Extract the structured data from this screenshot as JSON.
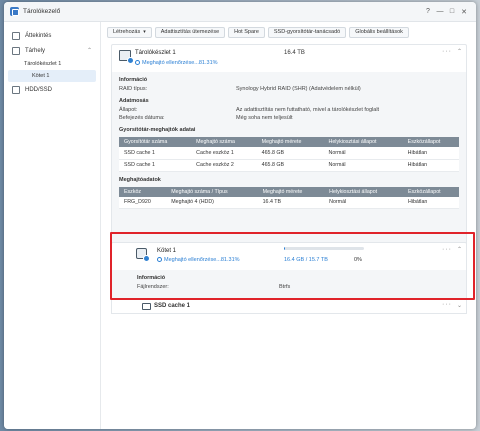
{
  "window": {
    "title": "Tárolókezelő",
    "controls": [
      "?",
      "—",
      "□",
      "✕"
    ]
  },
  "sidebar": {
    "items": [
      {
        "label": "Áttekintés",
        "icon": "overview-icon"
      },
      {
        "label": "Tárhely",
        "icon": "storage-icon"
      },
      {
        "label": "Tárolókészlet 1"
      },
      {
        "label": "Kötet 1"
      },
      {
        "label": "HDD/SSD",
        "icon": "hdd-icon"
      }
    ]
  },
  "toolbar": {
    "create_label": "Létrehozás",
    "schedule_label": "Adattisztítás ütemezése",
    "hotspare_label": "Hot Spare",
    "ssd_advisor_label": "SSD-gyorsítótár-tanácsadó",
    "global_settings_label": "Globális beállítások"
  },
  "pool": {
    "name": "Tárolókészlet 1",
    "status": "Meghajtó ellenőrzése...81.31%",
    "size": "16.4 TB",
    "info_title": "Információ",
    "raid_key": "RAID típus:",
    "raid_value": "Synology Hybrid RAID (SHR) (Adatvédelem nélkül)",
    "scrub_title": "Adatmosás",
    "state_key": "Állapot:",
    "state_value": "Az adattisztítás nem futtatható, mivel a tárolókészlet foglalt",
    "finished_key": "Befejezés dátuma:",
    "finished_value": "Még soha nem teljesült",
    "cache_title": "Gyorsítótár-meghajtók adatai",
    "cache_headers": [
      "Gyorsítótár száma",
      "Meghajtó száma",
      "Meghajtó mérete",
      "Helykiosztási állapot",
      "Eszközállapot"
    ],
    "cache_rows": [
      [
        "SSD cache 1",
        "Cache eszköz 1",
        "465.8 GB",
        "Normál",
        "Hibátlan"
      ],
      [
        "SSD cache 1",
        "Cache eszköz 2",
        "465.8 GB",
        "Normál",
        "Hibátlan"
      ]
    ],
    "drive_title": "Meghajtóadatok",
    "drive_headers": [
      "Eszköz",
      "Meghajtó száma / Típus",
      "Meghajtó mérete",
      "Helykiosztási állapot",
      "Eszközállapot"
    ],
    "drive_rows": [
      [
        "FRG_D920",
        "Meghajtó 4 (HDD)",
        "16.4 TB",
        "Normál",
        "Hibátlan"
      ]
    ]
  },
  "volume": {
    "name": "Kötet 1",
    "status": "Meghajtó ellenőrzése...81.31%",
    "used": "16.4 GB / 15.7 TB",
    "percent": "0%",
    "usage_fraction": 0.01,
    "info_title": "Információ",
    "fs_key": "Fájlrendszer:",
    "fs_value": "Btrfs"
  },
  "cache": {
    "name": "SSD cache 1"
  },
  "colors": {
    "accent": "#2a7fd4",
    "ok": "#2a9d3a",
    "highlight": "#e0232a"
  }
}
